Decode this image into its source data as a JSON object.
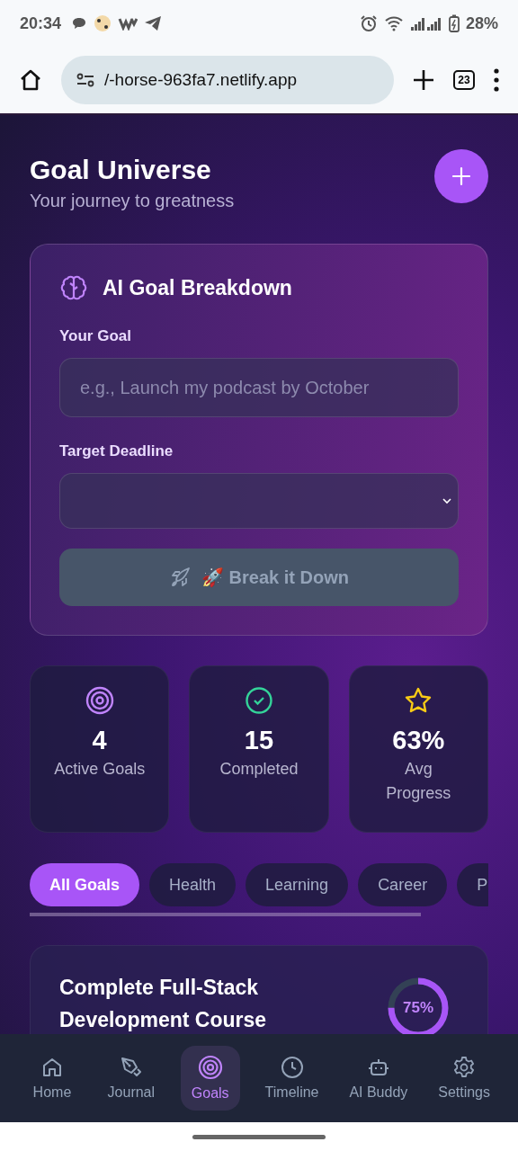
{
  "status_bar": {
    "time": "20:34",
    "battery": "28%"
  },
  "browser": {
    "url": "/-horse-963fa7.netlify.app",
    "tab_count": "23"
  },
  "header": {
    "title": "Goal Universe",
    "subtitle": "Your journey to greatness"
  },
  "breakdown": {
    "title": "AI Goal Breakdown",
    "goal_label": "Your Goal",
    "goal_placeholder": "e.g., Launch my podcast by October",
    "deadline_label": "Target Deadline",
    "button": "🚀 Break it Down",
    "button_disabled": true
  },
  "stats": [
    {
      "kind": "target",
      "value": "4",
      "label": "Active Goals"
    },
    {
      "kind": "check",
      "value": "15",
      "label": "Completed"
    },
    {
      "kind": "star",
      "value": "63%",
      "label": "Avg Progress"
    }
  ],
  "filters": [
    {
      "label": "All Goals",
      "selected": true
    },
    {
      "label": "Health",
      "selected": false
    },
    {
      "label": "Learning",
      "selected": false
    },
    {
      "label": "Career",
      "selected": false
    },
    {
      "label": "P",
      "selected": false
    }
  ],
  "goals": [
    {
      "title": "Complete Full-Stack Development Course",
      "progress": "75%",
      "level": 0.75
    }
  ],
  "nav": [
    {
      "kind": "home",
      "label": "Home",
      "selected": false
    },
    {
      "kind": "journal",
      "label": "Journal",
      "selected": false
    },
    {
      "kind": "goals",
      "label": "Goals",
      "selected": true
    },
    {
      "kind": "timeline",
      "label": "Timeline",
      "selected": false
    },
    {
      "kind": "buddy",
      "label": "AI Buddy",
      "selected": false
    },
    {
      "kind": "settings",
      "label": "Settings",
      "selected": false
    }
  ]
}
